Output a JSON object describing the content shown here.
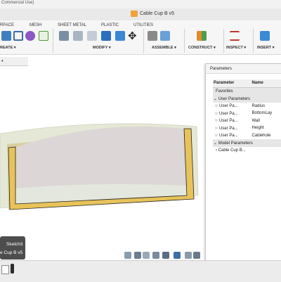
{
  "titlebar": {
    "license_text": "Commercial Use)"
  },
  "document": {
    "title": "Cable Cup B v5"
  },
  "toolbar": {
    "tabs": [
      "RFACE",
      "MESH",
      "SHEET METAL",
      "PLASTIC",
      "UTILITIES"
    ],
    "groups": [
      "REATE ▾",
      "MODIFY ▾",
      "ASSEMBLE ▾",
      "CONSTRUCT ▾",
      "INSPECT ▾",
      "INSERT ▾"
    ]
  },
  "colors": {
    "accent": "#0696d7",
    "solid_face": "#e5e8d6",
    "section_hatch": "#e8c35a",
    "cavity": "#dcd6d6"
  },
  "parameters_panel": {
    "title": "Parameters",
    "columns": {
      "parameter": "Parameter",
      "name": "Name"
    },
    "favorites_label": "Favorites",
    "user_group_label": "User Parameters",
    "user_rows": [
      {
        "type": "User Pa...",
        "name": "Radius"
      },
      {
        "type": "User Pa...",
        "name": "BottomLay"
      },
      {
        "type": "User Pa...",
        "name": "Wall"
      },
      {
        "type": "User Pa...",
        "name": "Height"
      },
      {
        "type": "User Pa...",
        "name": "Cablehole"
      }
    ],
    "model_group_label": "Model Parameters",
    "model_rows": [
      {
        "name": "Cable Cup B..."
      }
    ]
  },
  "tooltip": {
    "line1": "Sketch3",
    "line2": "e Cup B v5"
  },
  "icons": [
    "document-icon",
    "star-icon",
    "orbit-icon",
    "pan-icon",
    "zoom-icon",
    "display-icon",
    "grid-icon",
    "viewport-icon",
    "timeline-sketch-icon",
    "timeline-pin-icon"
  ]
}
